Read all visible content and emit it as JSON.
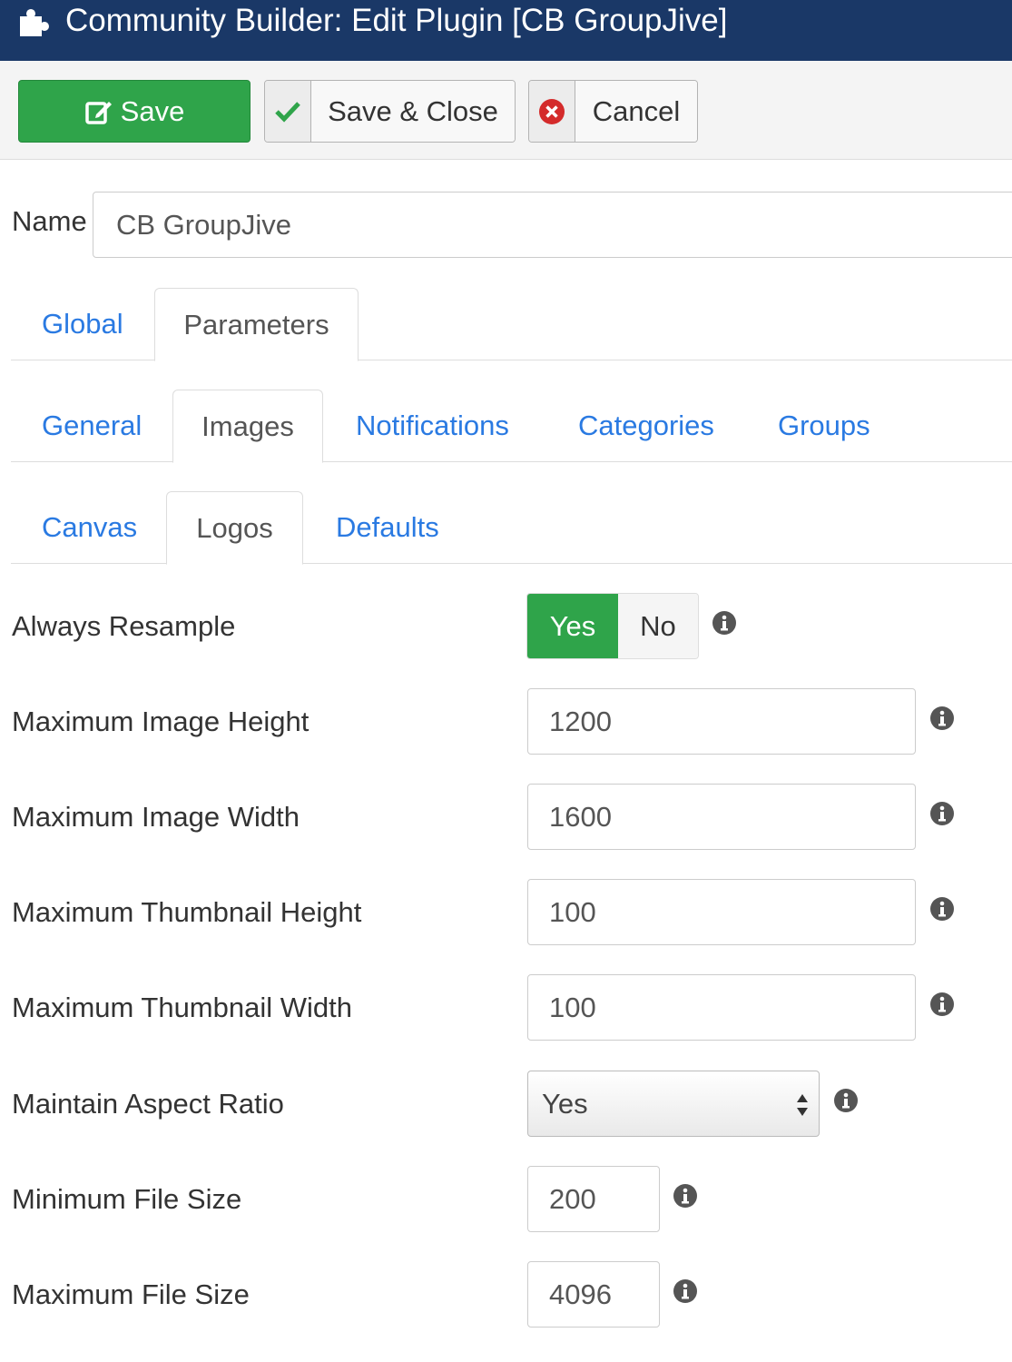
{
  "header": {
    "title": "Community Builder: Edit Plugin [CB GroupJive]",
    "icon": "puzzle-icon",
    "background": "#1a3867"
  },
  "toolbar": {
    "save_label": "Save",
    "save_close_label": "Save & Close",
    "cancel_label": "Cancel",
    "save_color": "#2fa44a"
  },
  "name_field": {
    "label": "Name",
    "value": "CB GroupJive"
  },
  "tabs": {
    "primary": [
      {
        "label": "Global",
        "active": false
      },
      {
        "label": "Parameters",
        "active": true
      }
    ],
    "secondary": [
      {
        "label": "General",
        "active": false
      },
      {
        "label": "Images",
        "active": true
      },
      {
        "label": "Notifications",
        "active": false
      },
      {
        "label": "Categories",
        "active": false
      },
      {
        "label": "Groups",
        "active": false
      }
    ],
    "tertiary": [
      {
        "label": "Canvas",
        "active": false
      },
      {
        "label": "Logos",
        "active": true
      },
      {
        "label": "Defaults",
        "active": false
      }
    ]
  },
  "fields": {
    "always_resample": {
      "label": "Always Resample",
      "yes": "Yes",
      "no": "No",
      "selected": "Yes"
    },
    "max_image_height": {
      "label": "Maximum Image Height",
      "value": "1200"
    },
    "max_image_width": {
      "label": "Maximum Image Width",
      "value": "1600"
    },
    "max_thumb_height": {
      "label": "Maximum Thumbnail Height",
      "value": "100"
    },
    "max_thumb_width": {
      "label": "Maximum Thumbnail Width",
      "value": "100"
    },
    "maintain_aspect": {
      "label": "Maintain Aspect Ratio",
      "value": "Yes"
    },
    "min_file_size": {
      "label": "Minimum File Size",
      "value": "200"
    },
    "max_file_size": {
      "label": "Maximum File Size",
      "value": "4096"
    }
  }
}
